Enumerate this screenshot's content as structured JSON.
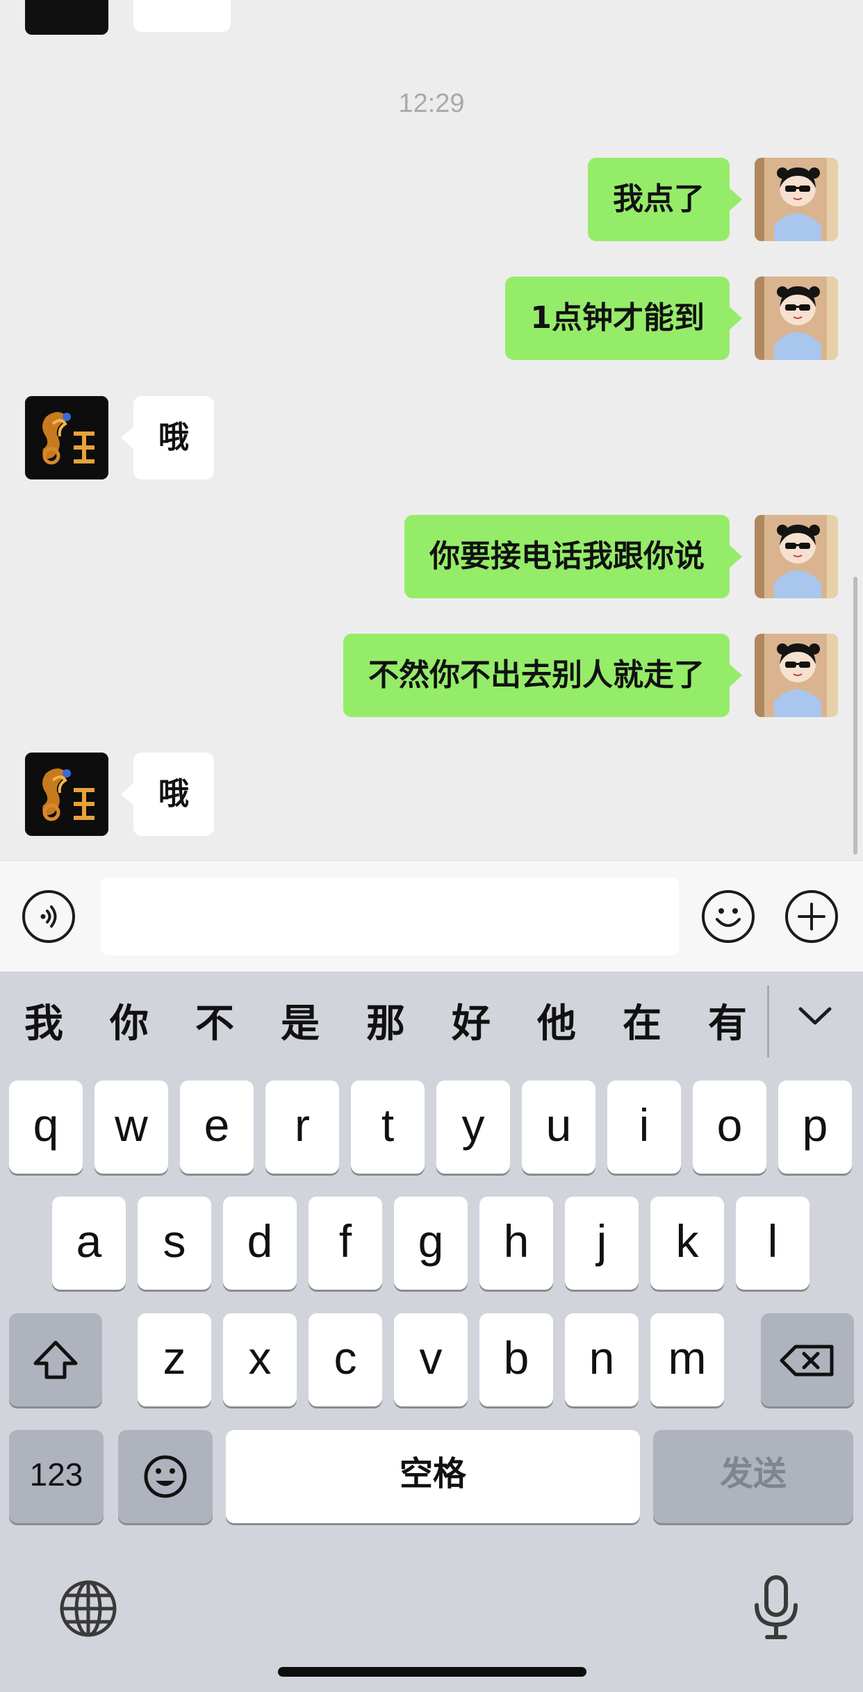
{
  "chat": {
    "timestamp": "12:29",
    "messages": [
      {
        "side": "me",
        "text": "我点了"
      },
      {
        "side": "me",
        "text": "1点钟才能到"
      },
      {
        "side": "them",
        "text": "哦"
      },
      {
        "side": "me",
        "text": "你要接电话我跟你说"
      },
      {
        "side": "me",
        "text": "不然你不出去别人就走了"
      },
      {
        "side": "them",
        "text": "哦"
      }
    ]
  },
  "input_bar": {
    "voice_icon": "voice-icon",
    "emoji_icon": "emoji-icon",
    "plus_icon": "plus-icon",
    "text_value": ""
  },
  "keyboard": {
    "candidates": [
      "我",
      "你",
      "不",
      "是",
      "那",
      "好",
      "他",
      "在",
      "有"
    ],
    "collapse_icon": "chevron-down-icon",
    "row1": [
      "q",
      "w",
      "e",
      "r",
      "t",
      "y",
      "u",
      "i",
      "o",
      "p"
    ],
    "row2": [
      "a",
      "s",
      "d",
      "f",
      "g",
      "h",
      "j",
      "k",
      "l"
    ],
    "row3": [
      "z",
      "x",
      "c",
      "v",
      "b",
      "n",
      "m"
    ],
    "numbers_label": "123",
    "space_label": "空格",
    "send_label": "发送",
    "globe_icon": "globe-icon",
    "mic_icon": "microphone-icon",
    "shift_icon": "shift-icon",
    "delete_icon": "delete-icon"
  },
  "colors": {
    "my_bubble": "#95ec69",
    "their_bubble": "#ffffff",
    "chat_bg": "#ededed",
    "keyboard_bg": "#d1d4db"
  }
}
